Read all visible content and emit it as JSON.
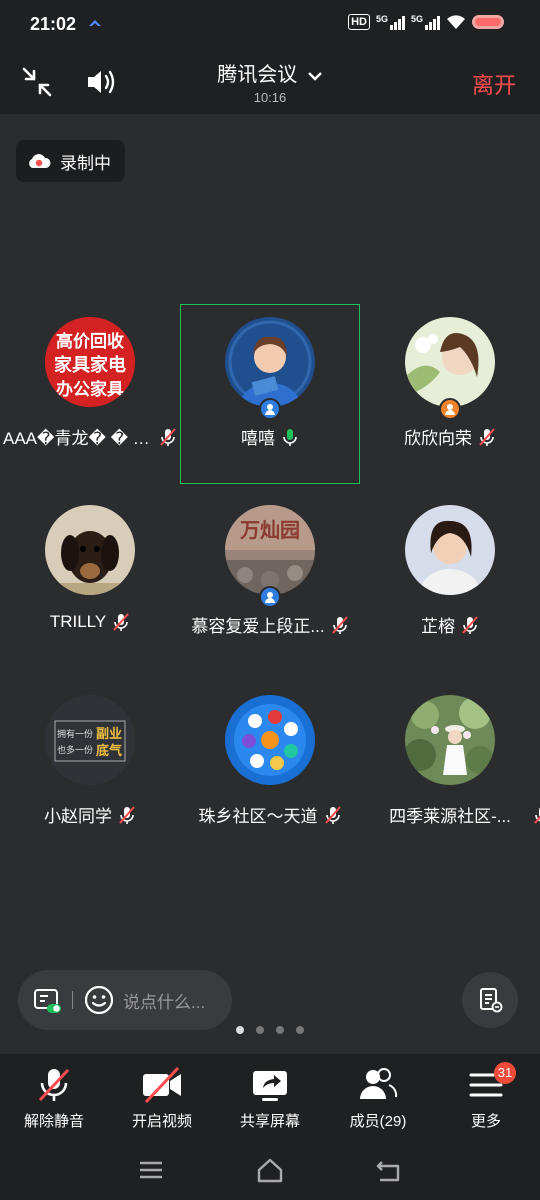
{
  "status_bar": {
    "time": "21:02",
    "hd": "HD",
    "net1": "5G",
    "net2": "5G"
  },
  "header": {
    "title": "腾讯会议",
    "duration": "10:16",
    "leave_label": "离开"
  },
  "recording": {
    "label": "录制中"
  },
  "participants": [
    {
      "name": "AAA�青龙� � 手...",
      "mic": "muted",
      "avatar_color": "#cc1f1f",
      "avatar_text": "高价回收 家具家电 办公家具"
    },
    {
      "name": "嘻嘻",
      "mic": "active",
      "avatar_color": "#2a5ea8",
      "badge": "host",
      "highlighted": true
    },
    {
      "name": "欣欣向荣",
      "mic": "muted",
      "avatar_color": "#d8e4c0",
      "badge": "cohost"
    },
    {
      "name": "TRILLY",
      "mic": "muted",
      "avatar_color": "#c9b89c"
    },
    {
      "name": "慕容复爱上段正...",
      "mic": "muted",
      "avatar_color": "#8a6e62",
      "badge": "host"
    },
    {
      "name": "芷榕",
      "mic": "muted",
      "avatar_color": "#c8d0de"
    },
    {
      "name": "小赵同学",
      "mic": "muted",
      "avatar_color": "#2e3238",
      "avatar_text": "拥有一份副业 也多一份底气"
    },
    {
      "name": "珠乡社区～天道",
      "mic": "muted",
      "avatar_color": "#1a6fd4"
    },
    {
      "name": "四季莱源社区-...",
      "mic": "muted",
      "avatar_color": "#5a7a4a"
    }
  ],
  "chat": {
    "placeholder": "说点什么..."
  },
  "pager": {
    "pages": 4,
    "current": 1
  },
  "toolbar": {
    "unmute": "解除静音",
    "video": "开启视频",
    "share": "共享屏幕",
    "members": "成员(29)",
    "more": "更多",
    "more_badge": "31"
  },
  "colors": {
    "leave": "#ff4d4f",
    "active_border": "#1fbf5b",
    "badge": "#f04a3a",
    "muted_mic": "#ff4d4f"
  }
}
